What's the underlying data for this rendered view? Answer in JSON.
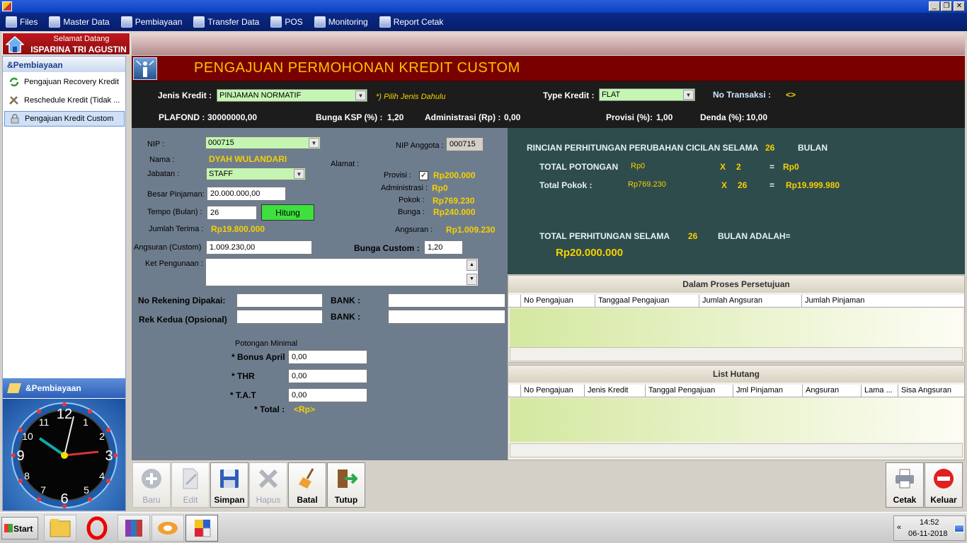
{
  "window": {
    "minimize": "_",
    "restore": "❐",
    "close": "✕"
  },
  "menu": [
    "Files",
    "Master Data",
    "Pembiayaan",
    "Transfer Data",
    "POS",
    "Monitoring",
    "Report Cetak"
  ],
  "welcome": {
    "greeting": "Selamat Datang",
    "user": "ISPARINA TRI AGUSTIN"
  },
  "sidebar": {
    "header": "&Pembiayaan",
    "items": [
      {
        "label": "Pengajuan Recovery Kredit"
      },
      {
        "label": "Reschedule Kredit (Tidak ..."
      },
      {
        "label": "Pengajuan Kredit Custom"
      }
    ],
    "bottom": "&Pembiayaan"
  },
  "form": {
    "title": "PENGAJUAN PERMOHONAN KREDIT CUSTOM",
    "jenis_kredit_label": "Jenis Kredit :",
    "jenis_kredit_value": "PINJAMAN NORMATIF",
    "hint": "*) Pilih Jenis Dahulu",
    "type_kredit_label": "Type Kredit :",
    "type_kredit_value": "FLAT",
    "no_transaksi_label": "No Transaksi :",
    "no_transaksi_value": "<>",
    "plafond_label": "PLAFOND :",
    "plafond_value": "30000000,00",
    "bunga_ksp_label": "Bunga KSP (%) :",
    "bunga_ksp_value": "1,20",
    "administrasi_label": "Administrasi (Rp) :",
    "administrasi_value": "0,00",
    "provisi_label": "Provisi (%):",
    "provisi_value": "1,00",
    "denda_label": "Denda (%):",
    "denda_value": "10,00",
    "nip_label": "NIP :",
    "nip_value": "000715",
    "nip_anggota_label": "NIP Anggota :",
    "nip_anggota_value": "000715",
    "nama_label": "Nama :",
    "nama_value": "DYAH WULANDARI",
    "alamat_label": "Alamat :",
    "jabatan_label": "Jabatan :",
    "jabatan_value": "STAFF",
    "provisi2_label": "Provisi :",
    "provisi2_value": "Rp200.000",
    "administrasi2_label": "Administrasi :",
    "administrasi2_value": "Rp0",
    "besar_pinjaman_label": "Besar Pinjaman:",
    "besar_pinjaman_value": "20.000.000,00",
    "pokok_label": "Pokok :",
    "pokok_value": "Rp769.230",
    "tempo_label": "Tempo (Bulan) :",
    "tempo_value": "26",
    "hitung_label": "Hitung",
    "bunga_label": "Bunga :",
    "bunga_value": "Rp240.000",
    "jumlah_terima_label": "Jumlah Terima :",
    "jumlah_terima_value": "Rp19.800.000",
    "angsuran_label": "Angsuran :",
    "angsuran_value": "Rp1.009.230",
    "angsuran_custom_label": "Angsuran (Custom)",
    "angsuran_custom_value": "1.009.230,00",
    "bunga_custom_label": "Bunga Custom :",
    "bunga_custom_value": "1,20",
    "ket_label": "Ket Pengunaan :",
    "no_rekening_label": "No Rekening Dipakai:",
    "rek_kedua_label": "Rek Kedua (Opsional)",
    "bank_label": "BANK :",
    "potongan_label": "Potongan Minimal",
    "bonus_label": "* Bonus April",
    "bonus_value": "0,00",
    "thr_label": "* THR",
    "thr_value": "0,00",
    "tat_label": "* T.A.T",
    "tat_value": "0,00",
    "total_label": "* Total :",
    "total_value": "<Rp>"
  },
  "calc": {
    "rincian_label": "RINCIAN PERHITUNGAN PERUBAHAN CICILAN SELAMA",
    "rincian_months": "26",
    "bulan": "BULAN",
    "total_potongan_label": "TOTAL POTONGAN",
    "total_potongan_value": "Rp0",
    "x": "X",
    "potongan_mult": "2",
    "eq": "=",
    "potongan_result": "Rp0",
    "total_pokok_label": "Total Pokok :",
    "total_pokok_value": "Rp769.230",
    "pokok_mult": "26",
    "pokok_result": "Rp19.999.980",
    "total_perhitungan_label": "TOTAL PERHITUNGAN SELAMA",
    "total_months": "26",
    "bulan_adalah": "BULAN ADALAH=",
    "grand_total": "Rp20.000.000"
  },
  "grid1": {
    "title": "Dalam Proses Persetujuan",
    "columns": [
      "No Pengajuan",
      "Tanggaal Pengajuan",
      "Jumlah Angsuran",
      "Jumlah Pinjaman"
    ]
  },
  "grid2": {
    "title": "List Hutang",
    "columns": [
      "No Pengajuan",
      "Jenis Kredit",
      "Tanggal Pengajuan",
      "Jml Pinjaman",
      "Angsuran",
      "Lama ...",
      "Sisa Angsuran"
    ]
  },
  "toolbar": {
    "baru": "Baru",
    "edit": "Edit",
    "simpan": "Simpan",
    "hapus": "Hapus",
    "batal": "Batal",
    "tutup": "Tutup",
    "cetak": "Cetak",
    "keluar": "Keluar"
  },
  "taskbar": {
    "start": "Start",
    "time": "14:52",
    "date": "06-11-2018",
    "tray_arrow": "«"
  },
  "colors": {
    "header_bg": "#7a0000",
    "title": "#f7c300",
    "highlight": "#f7d000",
    "calc_bg": "#2f4c4c",
    "form_bg": "#6e7d8e"
  }
}
